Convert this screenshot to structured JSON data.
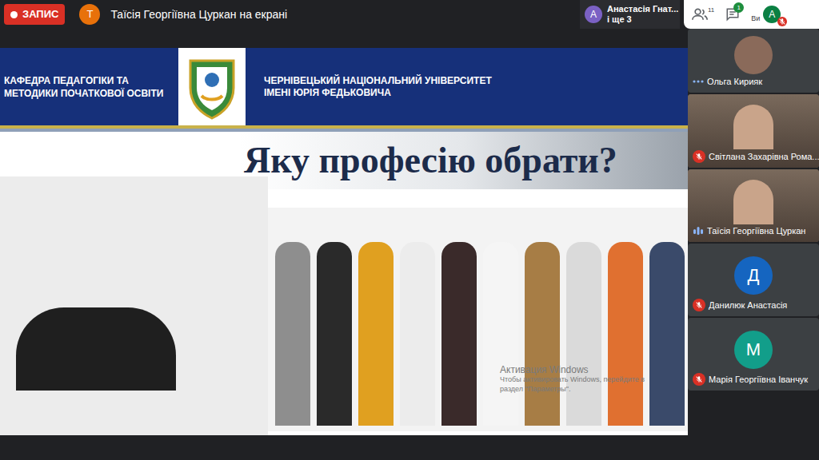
{
  "recording": {
    "label": "ЗАПИС"
  },
  "presenter": {
    "initial": "Т",
    "text": "Таїсія Георгіївна Цуркан на екрані"
  },
  "others": {
    "initial": "А",
    "name": "Анастасія Гнат...",
    "more": "і ще 3"
  },
  "toolbar": {
    "people_count": "11",
    "chat_badge": "1",
    "you_label": "Ви",
    "you_initial": "А",
    "you_muted": true
  },
  "slide": {
    "department": "КАФЕДРА ПЕДАГОГІКИ ТА МЕТОДИКИ ПОЧАТКОВОЇ ОСВІТИ",
    "university": "ЧЕРНІВЕЦЬКИЙ НАЦІОНАЛЬНИЙ УНІВЕРСИТЕТ ІМЕНІ ЮРІЯ ФЕДЬКОВИЧА",
    "title": "Яку професію обрати?"
  },
  "watermark": [
    "Активация Windows",
    "Чтобы активировать Windows, перейдите в",
    "раздел \"Параметры\"."
  ],
  "participants": [
    {
      "name": "Ольга Кирияк",
      "kind": "photo",
      "muted": false,
      "speaking": false
    },
    {
      "name": "Світлана Захарівна Рома...",
      "kind": "video",
      "muted": true,
      "speaking": false
    },
    {
      "name": "Таїсія Георгіївна Цуркан",
      "kind": "video",
      "muted": false,
      "speaking": true
    },
    {
      "name": "Данилюк Анастасія",
      "kind": "letter",
      "initial": "Д",
      "color": "#1565c0",
      "muted": true,
      "speaking": false
    },
    {
      "name": "Марія Георгіївна Іванчук",
      "kind": "letter",
      "initial": "М",
      "color": "#129e8a",
      "muted": true,
      "speaking": false
    }
  ]
}
